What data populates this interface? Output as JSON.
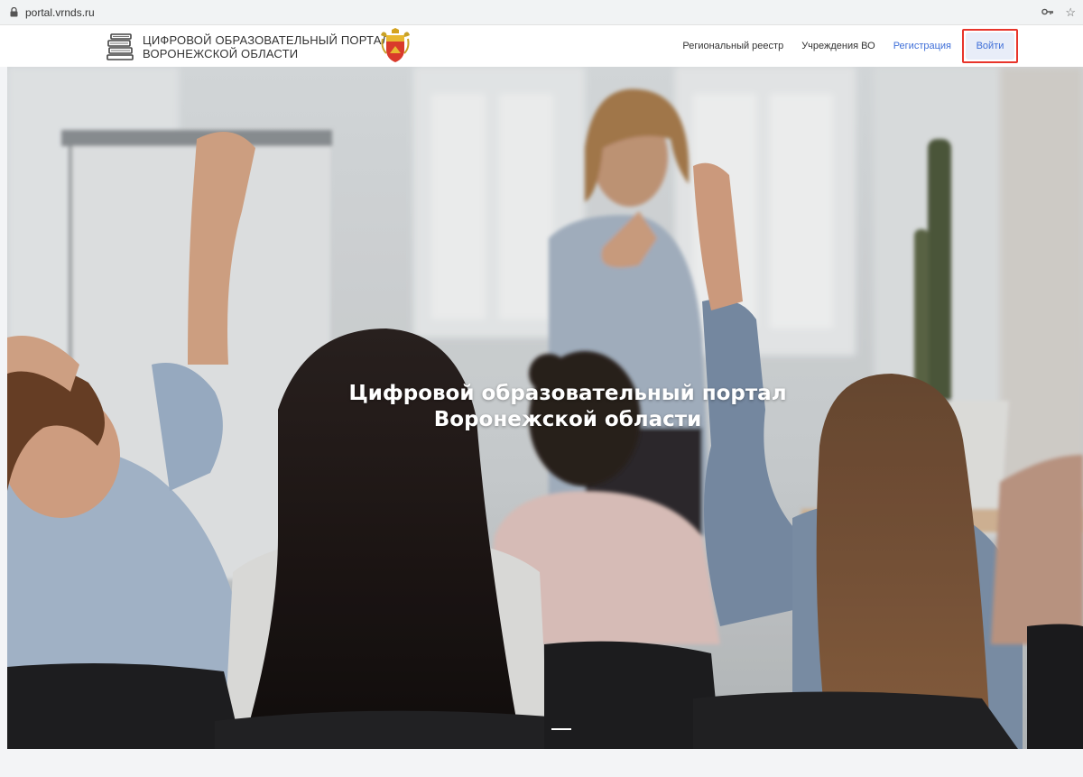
{
  "browser": {
    "url": "portal.vrnds.ru",
    "lock_icon": "lock-icon",
    "key_icon": "key-icon",
    "star_icon": "star-icon"
  },
  "header": {
    "brand_line1": "ЦИФРОВОЙ ОБРАЗОВАТЕЛЬНЫЙ ПОРТАЛ",
    "brand_line2": "ВОРОНЕЖСКОЙ ОБЛАСТИ",
    "nav": {
      "registry": "Региональный реестр",
      "institutions": "Учреждения ВО",
      "register": "Регистрация",
      "login": "Войти"
    }
  },
  "hero": {
    "title_line1": "Цифровой образовательный портал",
    "title_line2": "Воронежской области",
    "slides_total": 1,
    "active_slide": 1
  },
  "colors": {
    "accent": "#3f6fd8",
    "highlight": "#e8352b",
    "login_bg": "#e8edf8"
  }
}
